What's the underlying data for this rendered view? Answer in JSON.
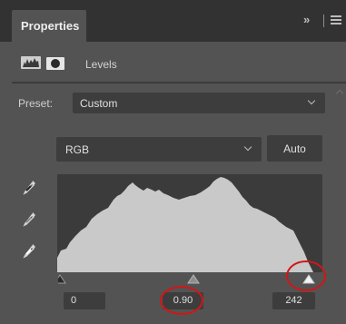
{
  "header": {
    "tab_label": "Properties",
    "collapse_glyph": "»",
    "menu_icon": "hamburger-menu-icon"
  },
  "subheader": {
    "histogram_icon": "levels-histogram-icon",
    "mask_icon": "layer-mask-icon",
    "title": "Levels"
  },
  "preset": {
    "label": "Preset:",
    "value": "Custom"
  },
  "channel": {
    "value": "RGB"
  },
  "auto_button": {
    "label": "Auto"
  },
  "eyedroppers": [
    {
      "name": "black-point-eyedropper-icon"
    },
    {
      "name": "gray-point-eyedropper-icon"
    },
    {
      "name": "white-point-eyedropper-icon"
    }
  ],
  "levels": {
    "black_input": "0",
    "gamma_input": "0.90",
    "white_input": "242",
    "black_slider_value": 0,
    "gamma_slider_value": 0.9,
    "white_slider_value": 242
  },
  "colors": {
    "panel_bg": "#535353",
    "header_bg": "#323232",
    "field_bg": "#3d3d3d",
    "histogram_fill": "#c9c9c9",
    "annotation_red": "#d21616"
  }
}
